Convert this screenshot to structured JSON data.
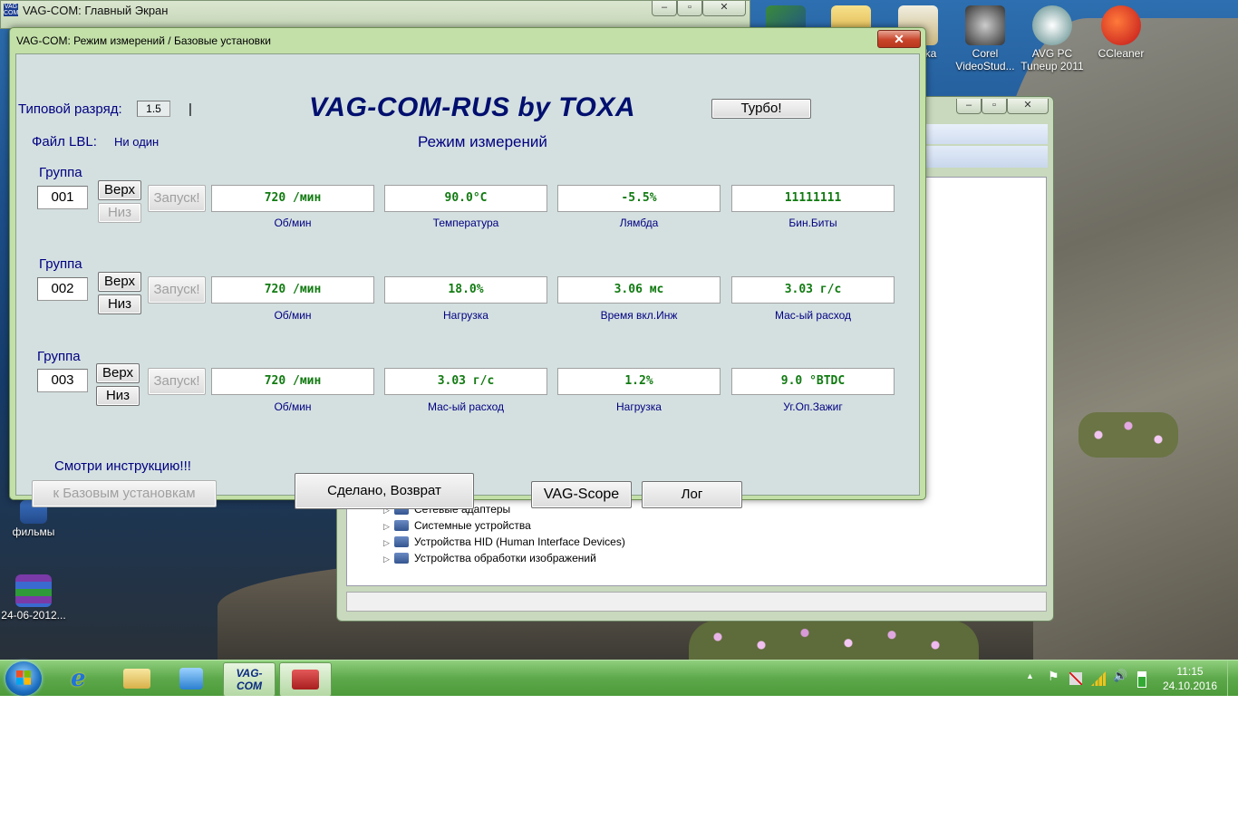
{
  "desktop": {
    "icons": [
      {
        "label": "ka"
      },
      {
        "label": "Corel\nVideoStud..."
      },
      {
        "label": "AVG PC\nTuneup 2011"
      },
      {
        "label": "CCleaner"
      },
      {
        "label": "фильмы"
      },
      {
        "label": "24-06-2012..."
      }
    ]
  },
  "main_window": {
    "icon_text": "VAG COM",
    "title": "VAG-COM: Главный Экран",
    "controls": {
      "minimize": "–",
      "maximize": "▫",
      "close": "✕"
    }
  },
  "device_manager": {
    "controls": {
      "minimize": "–",
      "maximize": "▫",
      "close": "✕"
    },
    "tree_items": [
      {
        "label": "Сетевые адаптеры"
      },
      {
        "label": "Системные устройства"
      },
      {
        "label": "Устройства HID (Human Interface Devices)"
      },
      {
        "label": "Устройства обработки изображений"
      }
    ]
  },
  "dialog": {
    "title": "VAG-COM: Режим измерений  / Базовые установки",
    "close": "✕",
    "type_label": "Типовой разряд:",
    "type_value": "1.5",
    "cursor": "|",
    "brand_title": "VAG-COM-RUS by TOXA",
    "turbo_button": "Турбо!",
    "lbl_file_label": "Файл LBL:",
    "lbl_file_value": "Ни один",
    "mode_title": "Режим измерений",
    "groups": [
      {
        "label": "Группа",
        "number": "001",
        "up": "Верх",
        "down": "Низ",
        "start": "Запуск!",
        "fields": [
          {
            "value": "720 /мин",
            "caption": "Об/мин"
          },
          {
            "value": "90.0°C",
            "caption": "Температура"
          },
          {
            "value": "-5.5%",
            "caption": "Лямбда"
          },
          {
            "value": "11111111",
            "caption": "Бин.Биты"
          }
        ]
      },
      {
        "label": "Группа",
        "number": "002",
        "up": "Верх",
        "down": "Низ",
        "start": "Запуск!",
        "fields": [
          {
            "value": "720 /мин",
            "caption": "Об/мин"
          },
          {
            "value": "18.0%",
            "caption": "Нагрузка"
          },
          {
            "value": "3.06 мс",
            "caption": "Время вкл.Инж"
          },
          {
            "value": "3.03 г/с",
            "caption": "Мас-ый расход"
          }
        ]
      },
      {
        "label": "Группа",
        "number": "003",
        "up": "Верх",
        "down": "Низ",
        "start": "Запуск!",
        "fields": [
          {
            "value": "720 /мин",
            "caption": "Об/мин"
          },
          {
            "value": "3.03 г/с",
            "caption": "Мас-ый расход"
          },
          {
            "value": "1.2%",
            "caption": "Нагрузка"
          },
          {
            "value": "9.0 °BTDC",
            "caption": "Уг.Оп.Зажиг"
          }
        ]
      }
    ],
    "instruction_text": "Смотри инструкцию!!!",
    "basic_settings_button": "к Базовым установкам",
    "done_button": "Сделано, Возврат",
    "vagscope_button": "VAG-Scope",
    "log_button": "Лог"
  },
  "taskbar": {
    "active_item_text": "VAG- COM",
    "clock_time": "11:15",
    "clock_date": "24.10.2016",
    "tray_arrow": "▲",
    "tray_flag": "⚑",
    "tray_volume": "🔊",
    "tray_ie": "e"
  }
}
